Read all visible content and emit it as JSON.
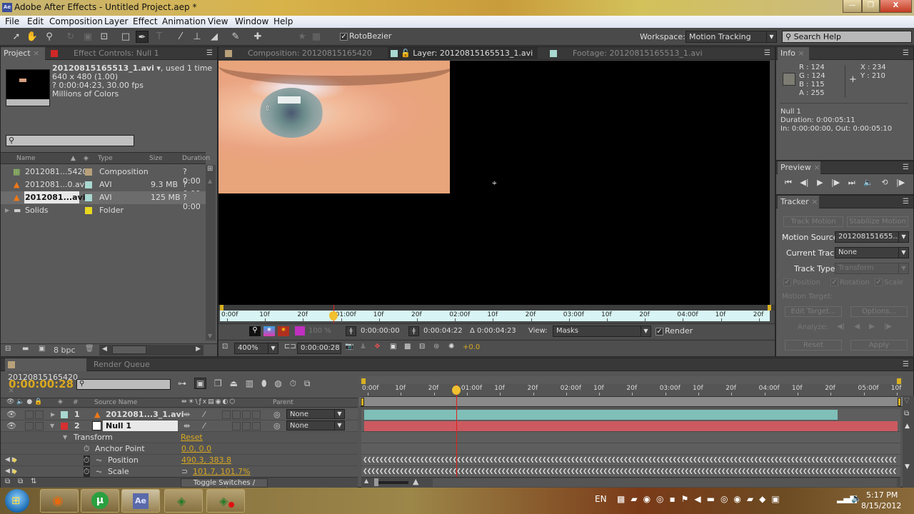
{
  "window": {
    "app_icon": "Ae",
    "title": "Adobe After Effects - Untitled Project.aep *",
    "controls": {
      "minimize": "—",
      "maximize": "❐",
      "close": "X"
    }
  },
  "menu": [
    "File",
    "Edit",
    "Composition",
    "Layer",
    "Effect",
    "Animation",
    "View",
    "Window",
    "Help"
  ],
  "toolbar": {
    "tools": [
      "selection-tool",
      "hand-tool",
      "zoom-tool",
      "rotation-tool",
      "camera-tool",
      "pan-behind-tool",
      "rectangle-tool",
      "pen-tool",
      "type-tool",
      "brush-tool",
      "clone-stamp-tool",
      "eraser-tool",
      "roto-brush-tool",
      "puppet-pin-tool"
    ],
    "rotobezier_label": "RotoBezier",
    "rotobezier_checked": true,
    "workspace_label": "Workspace:",
    "workspace_value": "Motion Tracking",
    "search_placeholder": "Search Help"
  },
  "project_panel": {
    "tabs": [
      {
        "label": "Project",
        "active": true
      },
      {
        "label": "Effect Controls: Null 1",
        "active": false
      }
    ],
    "selected_item": {
      "name": "20120815165513_1.avi",
      "usage": ", used 1 time",
      "dimensions": "640 x 480 (1.00)",
      "duration_fps": "? 0:00:04:23, 30.00 fps",
      "colors": "Millions of Colors"
    },
    "search_value": "",
    "columns": [
      "Name",
      "Type",
      "Size",
      "Duration"
    ],
    "items": [
      {
        "name": "2012081...5420",
        "type": "Composition",
        "size": "",
        "duration": "? 0:00",
        "label_color": "#b8a07a",
        "icon": "composition-icon",
        "selected": false
      },
      {
        "name": "2012081...0.avi",
        "type": "AVI",
        "size": "9.3 MB",
        "duration": "? 0:00",
        "label_color": "#a8d8d0",
        "icon": "vlc-cone-icon",
        "selected": false
      },
      {
        "name": "2012081...avi",
        "type": "AVI",
        "size": "125 MB",
        "duration": "? 0:00",
        "label_color": "#a8d8d0",
        "icon": "vlc-cone-icon",
        "selected": true
      },
      {
        "name": "Solids",
        "type": "Folder",
        "size": "",
        "duration": "",
        "label_color": "#e8d820",
        "icon": "folder-icon",
        "selected": false
      }
    ],
    "bit_depth": "8 bpc"
  },
  "viewer": {
    "tabs": [
      {
        "label": "Composition: 20120815165420",
        "active": false
      },
      {
        "label": "Layer: 20120815165513_1.avi",
        "active": true
      },
      {
        "label": "Footage: 20120815165513_1.avi",
        "active": false
      }
    ],
    "ruler_ticks": [
      "0:00f",
      "10f",
      "20f",
      "01:00f",
      "10f",
      "20f",
      "02:00f",
      "10f",
      "20f",
      "03:00f",
      "10f",
      "20f",
      "04:00f",
      "10f",
      "20f"
    ],
    "in_time": "0:00:00:00",
    "out_time": "0:00:04:22",
    "duration": "Δ 0:00:04:23",
    "opacity": "100 %",
    "view_label": "View:",
    "view_value": "Masks",
    "render_label": "Render",
    "render_checked": true,
    "zoom": "400%",
    "current_time": "0:00:00:28",
    "exposure": "+0.0"
  },
  "info_panel": {
    "tab": "Info",
    "r": "R : 124",
    "g": "G : 124",
    "b": "B : 115",
    "a": "A : 255",
    "x": "X : 234",
    "y": "Y : 210",
    "sample_color": "#7c7c73",
    "layer_name": "Null 1",
    "duration": "Duration: 0:00:05:11",
    "in_out": "In: 0:00:00:00, Out: 0:00:05:10"
  },
  "preview_panel": {
    "tab": "Preview",
    "controls": [
      "first-frame",
      "prev-frame",
      "play",
      "next-frame",
      "last-frame",
      "audio",
      "loop",
      "ram-preview"
    ]
  },
  "tracker_panel": {
    "tab": "Tracker",
    "track_motion": "Track Motion",
    "stabilize_motion": "Stabilize Motion",
    "motion_source_label": "Motion Source:",
    "motion_source_value": "201208151655...",
    "current_track_label": "Current Track:",
    "current_track_value": "None",
    "track_type_label": "Track Type:",
    "track_type_value": "Transform",
    "checkboxes": [
      {
        "label": "Position",
        "checked": true
      },
      {
        "label": "Rotation",
        "checked": true
      },
      {
        "label": "Scale",
        "checked": true
      }
    ],
    "motion_target_label": "Motion Target:",
    "edit_target": "Edit Target...",
    "options": "Options...",
    "analyze_label": "Analyze:",
    "reset": "Reset",
    "apply": "Apply"
  },
  "timeline": {
    "tabs": [
      {
        "label": "20120815165420",
        "active": true
      },
      {
        "label": "Render Queue",
        "active": false
      }
    ],
    "current_time": "0:00:00:28",
    "search_value": "",
    "columns": {
      "number": "#",
      "source": "Source Name",
      "parent": "Parent"
    },
    "ruler_ticks": [
      "0:00f",
      "10f",
      "20f",
      "01:00f",
      "10f",
      "20f",
      "02:00f",
      "10f",
      "20f",
      "03:00f",
      "10f",
      "20f",
      "04:00f",
      "10f",
      "20f",
      "05:00f",
      "10f"
    ],
    "layers": [
      {
        "index": "1",
        "name": "2012081...3_1.avi",
        "label_color": "#a8d8d0",
        "parent": "None",
        "bar_color": "#7fbfb8",
        "expanded": false,
        "selected": false
      },
      {
        "index": "2",
        "name": "Null 1",
        "label_color": "#d83030",
        "parent": "None",
        "bar_color": "#cc5a60",
        "expanded": true,
        "selected": true
      }
    ],
    "transform": {
      "label": "Transform",
      "reset": "Reset",
      "properties": [
        {
          "name": "Anchor Point",
          "value": "0.0, 0.0",
          "keyframed": false
        },
        {
          "name": "Position",
          "value": "490.3, 383.8",
          "keyframed": true
        },
        {
          "name": "Scale",
          "value": "101.7, 101.7%",
          "keyframed": true,
          "linked": true
        }
      ]
    },
    "toggle_label": "Toggle Switches / Modes"
  },
  "taskbar": {
    "apps": [
      "windows-start",
      "firefox",
      "utorrent",
      "after-effects",
      "camtasia",
      "camtasia-recorder"
    ],
    "language": "EN",
    "time": "5:17 PM",
    "date": "8/15/2012"
  }
}
